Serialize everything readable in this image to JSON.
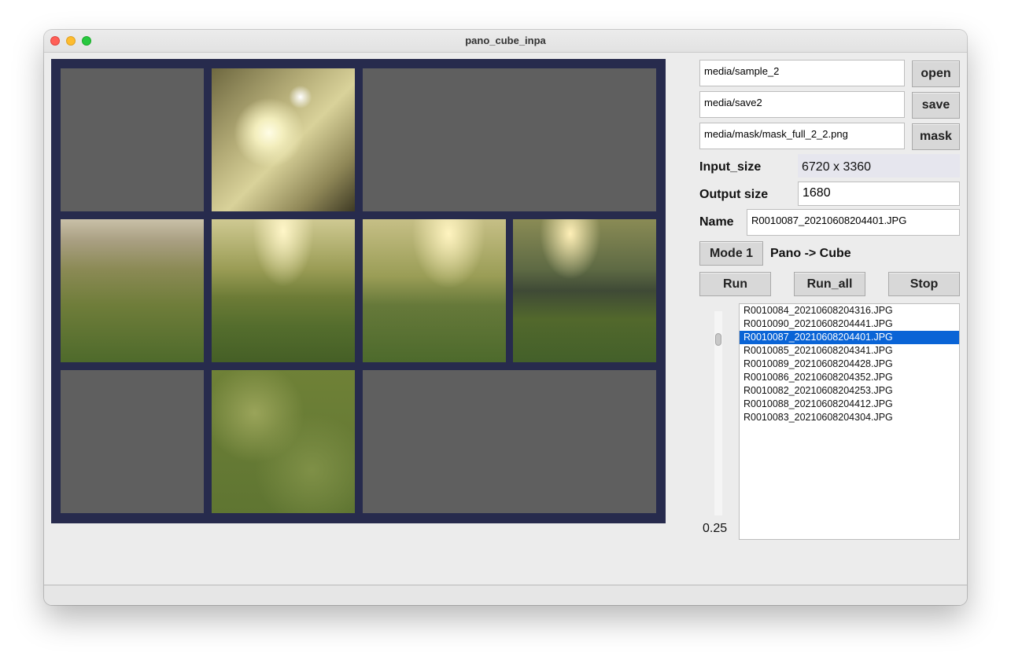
{
  "window": {
    "title": "pano_cube_inpa"
  },
  "paths": {
    "input": "media/sample_2",
    "save": "media/save2",
    "mask": "media/mask/mask_full_2_2.png"
  },
  "buttons": {
    "open": "open",
    "save": "save",
    "mask": "mask",
    "mode": "Mode 1",
    "run": "Run",
    "run_all": "Run_all",
    "stop": "Stop"
  },
  "info": {
    "input_size_label": "Input_size",
    "input_size_value": "6720 x 3360",
    "output_size_label": "Output size",
    "output_size_value": "1680",
    "name_label": "Name",
    "name_value": "R0010087_20210608204401.JPG",
    "mode_desc": "Pano -> Cube"
  },
  "slider": {
    "value": "0.25"
  },
  "files": [
    "R0010084_20210608204316.JPG",
    "R0010090_20210608204441.JPG",
    "R0010087_20210608204401.JPG",
    "R0010085_20210608204341.JPG",
    "R0010089_20210608204428.JPG",
    "R0010086_20210608204352.JPG",
    "R0010082_20210608204253.JPG",
    "R0010088_20210608204412.JPG",
    "R0010083_20210608204304.JPG"
  ],
  "selected_file_index": 2
}
